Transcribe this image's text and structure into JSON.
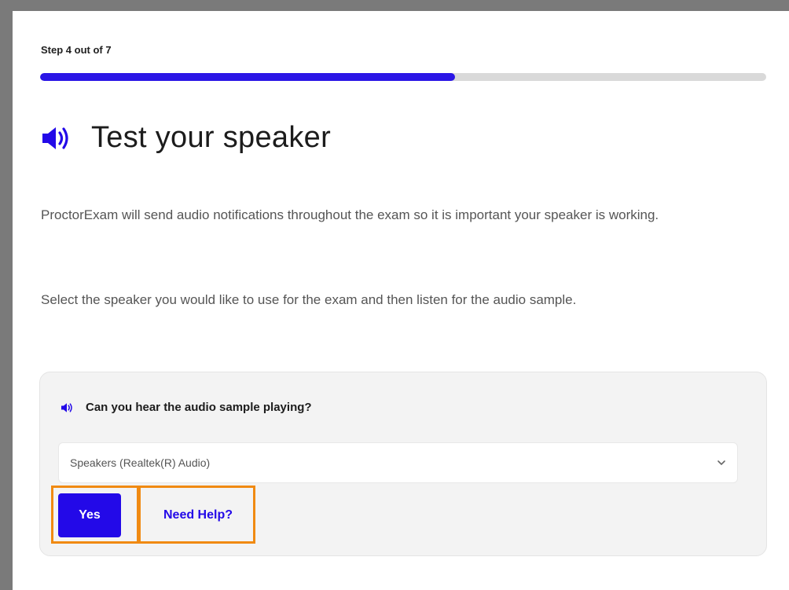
{
  "progress": {
    "step_label": "Step 4 out of 7",
    "value": 0.571
  },
  "header": {
    "title": "Test your speaker",
    "icon": "speaker-icon"
  },
  "description": {
    "paragraph1": "ProctorExam will send audio notifications throughout the exam so it is important your speaker is working.",
    "paragraph2": "Select the speaker you would like to use for the exam and then listen for the audio sample."
  },
  "card": {
    "question": "Can you hear the audio sample playing?",
    "question_icon": "speaker-icon",
    "speaker_select": {
      "selected": "Speakers (Realtek(R) Audio)"
    },
    "yes_label": "Yes",
    "help_label": "Need Help?"
  },
  "colors": {
    "accent": "#2309e8",
    "highlight": "#f08a12",
    "track": "#d9d9d9"
  }
}
